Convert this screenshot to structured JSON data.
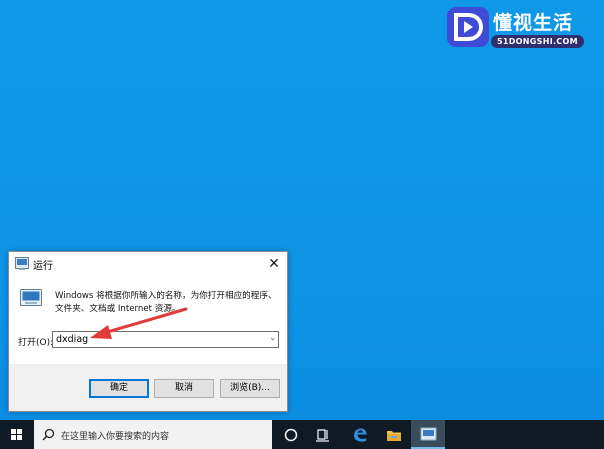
{
  "watermark": {
    "title": "懂视生活",
    "subtitle": "51DONGSHI.COM"
  },
  "dialog": {
    "title": "运行",
    "description": "Windows 将根据你所输入的名称，为你打开相应的程序、文件夹、文档或 Internet 资源。",
    "open_label": "打开(O):",
    "input_value": "dxdiag",
    "ok_label": "确定",
    "cancel_label": "取消",
    "browse_label": "浏览(B)..."
  },
  "taskbar": {
    "search_placeholder": "在这里输入你要搜索的内容",
    "items": [
      "start-icon",
      "search-icon",
      "cortana-icon",
      "task-view-icon",
      "edge-icon",
      "file-explorer-icon",
      "run-app-icon"
    ]
  },
  "colors": {
    "desktop": "#1098e8",
    "taskbar": "#0e1a24",
    "accent": "#0078d7",
    "annotation": "#e03a3a"
  }
}
